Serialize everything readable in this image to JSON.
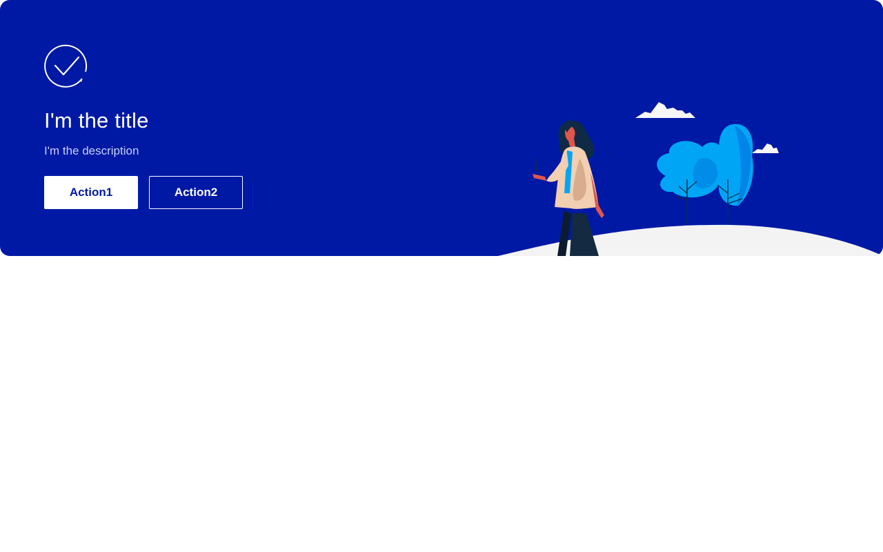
{
  "banner": {
    "title": "I'm the title",
    "description": "I'm the description",
    "status_icon": "check-circle-icon",
    "actions": {
      "primary_label": "Action1",
      "secondary_label": "Action2"
    },
    "illustration": "woman-walking-with-trees-illustration"
  },
  "colors": {
    "banner_background": "#0019a5",
    "primary_button_text": "#0019a5",
    "ground": "#f3f3f3",
    "tree_light": "#00a6f5",
    "tree_dark": "#0078e0"
  }
}
